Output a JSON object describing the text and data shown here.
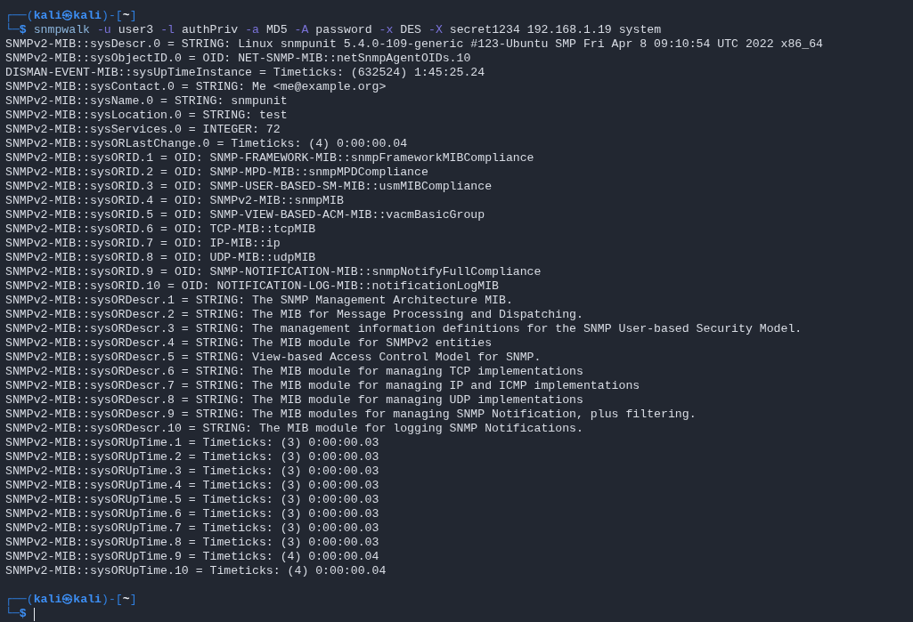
{
  "terminal": {
    "blocks": [
      {
        "kind": "prompt",
        "top": [
          {
            "kind": "frame",
            "text": "┌──("
          },
          {
            "kind": "user",
            "text": "kali㉿kali"
          },
          {
            "kind": "frame",
            "text": ")-["
          },
          {
            "kind": "cwd",
            "text": "~"
          },
          {
            "kind": "frame",
            "text": "]"
          }
        ],
        "bottom": [
          {
            "kind": "frame",
            "text": "└─"
          },
          {
            "kind": "symbol",
            "text": "$"
          }
        ],
        "command": [
          {
            "kind": "program",
            "text": "snmpwalk"
          },
          {
            "kind": "option",
            "text": "-u"
          },
          {
            "kind": "arg",
            "text": "user3"
          },
          {
            "kind": "option",
            "text": "-l"
          },
          {
            "kind": "arg",
            "text": "authPriv"
          },
          {
            "kind": "option",
            "text": "-a"
          },
          {
            "kind": "arg",
            "text": "MD5"
          },
          {
            "kind": "option",
            "text": "-A"
          },
          {
            "kind": "arg",
            "text": "password"
          },
          {
            "kind": "option",
            "text": "-x"
          },
          {
            "kind": "arg",
            "text": "DES"
          },
          {
            "kind": "option",
            "text": "-X"
          },
          {
            "kind": "arg",
            "text": "secret1234"
          },
          {
            "kind": "arg",
            "text": "192.168.1.19"
          },
          {
            "kind": "arg",
            "text": "system"
          }
        ]
      },
      {
        "kind": "output",
        "lines": [
          "SNMPv2-MIB::sysDescr.0 = STRING: Linux snmpunit 5.4.0-109-generic #123-Ubuntu SMP Fri Apr 8 09:10:54 UTC 2022 x86_64",
          "SNMPv2-MIB::sysObjectID.0 = OID: NET-SNMP-MIB::netSnmpAgentOIDs.10",
          "DISMAN-EVENT-MIB::sysUpTimeInstance = Timeticks: (632524) 1:45:25.24",
          "SNMPv2-MIB::sysContact.0 = STRING: Me <me@example.org>",
          "SNMPv2-MIB::sysName.0 = STRING: snmpunit",
          "SNMPv2-MIB::sysLocation.0 = STRING: test",
          "SNMPv2-MIB::sysServices.0 = INTEGER: 72",
          "SNMPv2-MIB::sysORLastChange.0 = Timeticks: (4) 0:00:00.04",
          "SNMPv2-MIB::sysORID.1 = OID: SNMP-FRAMEWORK-MIB::snmpFrameworkMIBCompliance",
          "SNMPv2-MIB::sysORID.2 = OID: SNMP-MPD-MIB::snmpMPDCompliance",
          "SNMPv2-MIB::sysORID.3 = OID: SNMP-USER-BASED-SM-MIB::usmMIBCompliance",
          "SNMPv2-MIB::sysORID.4 = OID: SNMPv2-MIB::snmpMIB",
          "SNMPv2-MIB::sysORID.5 = OID: SNMP-VIEW-BASED-ACM-MIB::vacmBasicGroup",
          "SNMPv2-MIB::sysORID.6 = OID: TCP-MIB::tcpMIB",
          "SNMPv2-MIB::sysORID.7 = OID: IP-MIB::ip",
          "SNMPv2-MIB::sysORID.8 = OID: UDP-MIB::udpMIB",
          "SNMPv2-MIB::sysORID.9 = OID: SNMP-NOTIFICATION-MIB::snmpNotifyFullCompliance",
          "SNMPv2-MIB::sysORID.10 = OID: NOTIFICATION-LOG-MIB::notificationLogMIB",
          "SNMPv2-MIB::sysORDescr.1 = STRING: The SNMP Management Architecture MIB.",
          "SNMPv2-MIB::sysORDescr.2 = STRING: The MIB for Message Processing and Dispatching.",
          "SNMPv2-MIB::sysORDescr.3 = STRING: The management information definitions for the SNMP User-based Security Model.",
          "SNMPv2-MIB::sysORDescr.4 = STRING: The MIB module for SNMPv2 entities",
          "SNMPv2-MIB::sysORDescr.5 = STRING: View-based Access Control Model for SNMP.",
          "SNMPv2-MIB::sysORDescr.6 = STRING: The MIB module for managing TCP implementations",
          "SNMPv2-MIB::sysORDescr.7 = STRING: The MIB module for managing IP and ICMP implementations",
          "SNMPv2-MIB::sysORDescr.8 = STRING: The MIB module for managing UDP implementations",
          "SNMPv2-MIB::sysORDescr.9 = STRING: The MIB modules for managing SNMP Notification, plus filtering.",
          "SNMPv2-MIB::sysORDescr.10 = STRING: The MIB module for logging SNMP Notifications.",
          "SNMPv2-MIB::sysORUpTime.1 = Timeticks: (3) 0:00:00.03",
          "SNMPv2-MIB::sysORUpTime.2 = Timeticks: (3) 0:00:00.03",
          "SNMPv2-MIB::sysORUpTime.3 = Timeticks: (3) 0:00:00.03",
          "SNMPv2-MIB::sysORUpTime.4 = Timeticks: (3) 0:00:00.03",
          "SNMPv2-MIB::sysORUpTime.5 = Timeticks: (3) 0:00:00.03",
          "SNMPv2-MIB::sysORUpTime.6 = Timeticks: (3) 0:00:00.03",
          "SNMPv2-MIB::sysORUpTime.7 = Timeticks: (3) 0:00:00.03",
          "SNMPv2-MIB::sysORUpTime.8 = Timeticks: (3) 0:00:00.03",
          "SNMPv2-MIB::sysORUpTime.9 = Timeticks: (4) 0:00:00.04",
          "SNMPv2-MIB::sysORUpTime.10 = Timeticks: (4) 0:00:00.04"
        ]
      },
      {
        "kind": "prompt",
        "top": [
          {
            "kind": "frame",
            "text": "┌──("
          },
          {
            "kind": "user",
            "text": "kali㉿kali"
          },
          {
            "kind": "frame",
            "text": ")-["
          },
          {
            "kind": "cwd",
            "text": "~"
          },
          {
            "kind": "frame",
            "text": "]"
          }
        ],
        "bottom": [
          {
            "kind": "frame",
            "text": "└─"
          },
          {
            "kind": "symbol",
            "text": "$"
          }
        ]
      }
    ]
  }
}
